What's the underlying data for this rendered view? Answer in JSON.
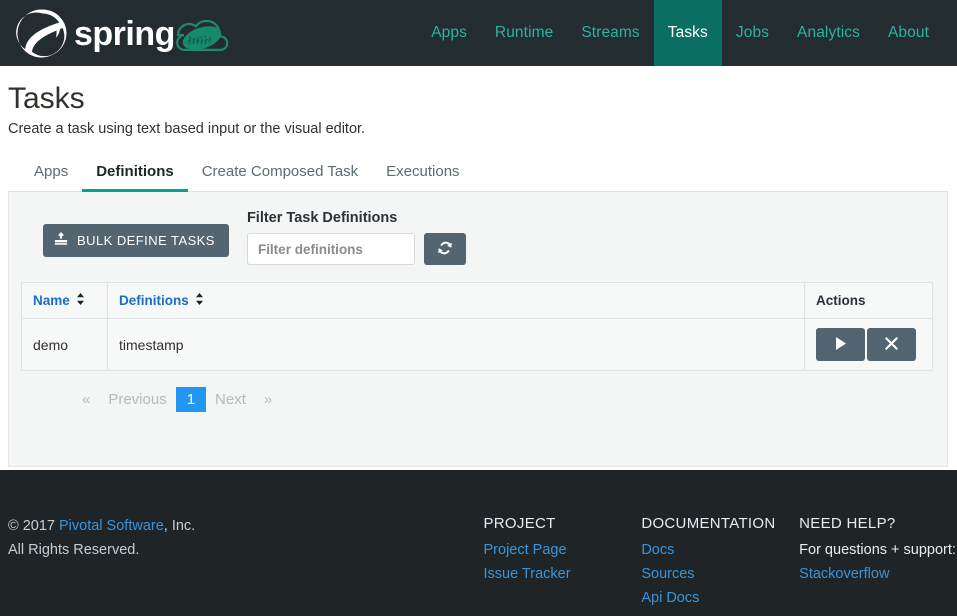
{
  "header": {
    "brand": "spring",
    "brand_icon": "spring-leaf-logo",
    "cloud_icon": "spring-cloud-dataflow-logo",
    "nav": [
      {
        "label": "Apps",
        "active": false
      },
      {
        "label": "Runtime",
        "active": false
      },
      {
        "label": "Streams",
        "active": false
      },
      {
        "label": "Tasks",
        "active": true
      },
      {
        "label": "Jobs",
        "active": false
      },
      {
        "label": "Analytics",
        "active": false
      },
      {
        "label": "About",
        "active": false
      }
    ],
    "active_nav_bg": "#0a6e62",
    "nav_link_color": "#2bb3a3",
    "bar_bg": "#222c31"
  },
  "page": {
    "title": "Tasks",
    "subtitle": "Create a task using text based input or the visual editor."
  },
  "tabs": [
    {
      "label": "Apps",
      "active": false
    },
    {
      "label": "Definitions",
      "active": true
    },
    {
      "label": "Create Composed Task",
      "active": false
    },
    {
      "label": "Executions",
      "active": false
    }
  ],
  "tab_accent": "#00a396",
  "toolbar": {
    "bulk_button_label": "BULK DEFINE TASKS",
    "bulk_button_icon": "upload-icon",
    "filter_label": "Filter Task Definitions",
    "filter_placeholder": "Filter definitions",
    "filter_value": "",
    "refresh_icon": "refresh-icon",
    "button_bg": "#536570"
  },
  "table": {
    "columns": [
      {
        "label": "Name",
        "sortable": true
      },
      {
        "label": "Definitions",
        "sortable": true
      },
      {
        "label": "Actions",
        "sortable": false
      }
    ],
    "rows": [
      {
        "name": "demo",
        "definition": "timestamp",
        "actions": [
          {
            "icon": "play-icon",
            "name": "launch-task-button"
          },
          {
            "icon": "close-icon",
            "name": "destroy-task-button"
          }
        ]
      }
    ]
  },
  "pagination": {
    "first_symbol": "«",
    "previous_label": "Previous",
    "current_page": "1",
    "next_label": "Next",
    "last_symbol": "»",
    "active_color": "#2196f3"
  },
  "footer": {
    "copyright_prefix": "© 2017 ",
    "copyright_link": "Pivotal Software",
    "copyright_suffix": ", Inc.",
    "rights": "All Rights Reserved.",
    "columns": [
      {
        "heading": "PROJECT",
        "links": [
          "Project Page",
          "Issue Tracker"
        ],
        "text": ""
      },
      {
        "heading": "DOCUMENTATION",
        "links": [
          "Docs",
          "Sources",
          "Api Docs"
        ],
        "text": ""
      },
      {
        "heading": "NEED HELP?",
        "links": [
          "Stackoverflow"
        ],
        "text": "For questions + support:"
      }
    ],
    "link_color": "#3b94d9",
    "bg": "#1f2427"
  }
}
